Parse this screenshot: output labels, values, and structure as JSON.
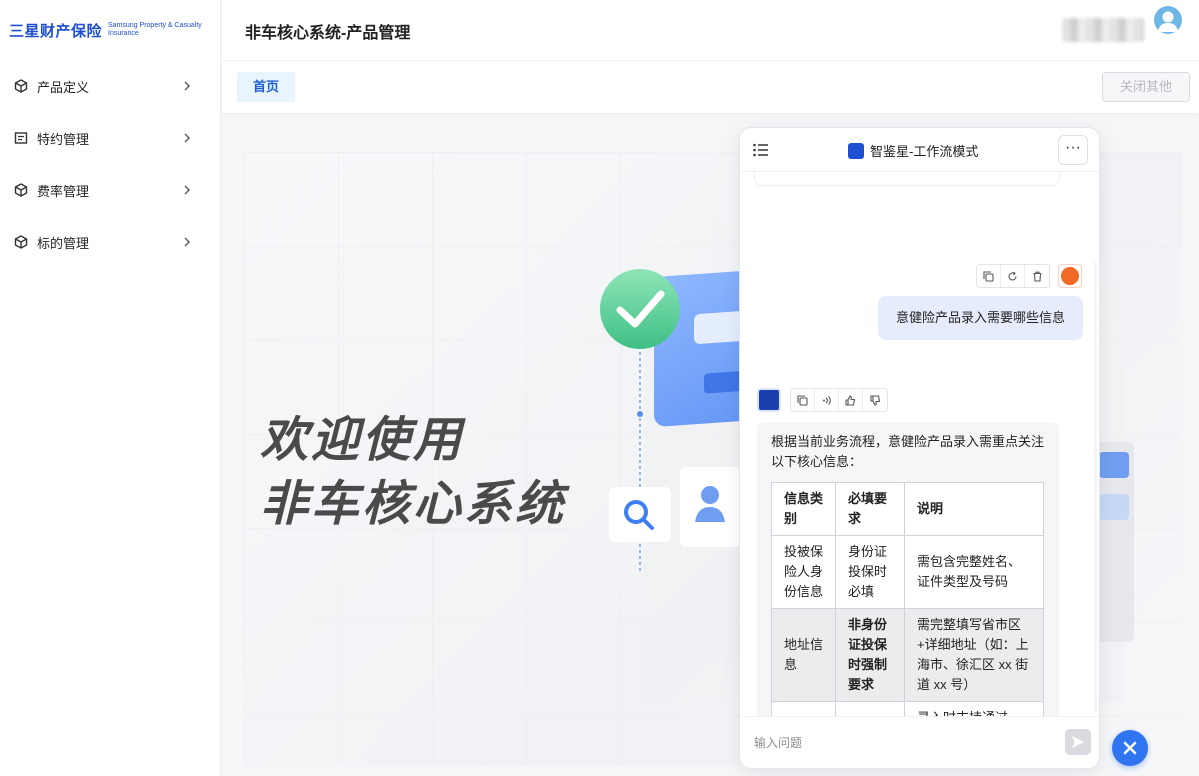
{
  "logo": {
    "main": "三星财产保险",
    "sub": "Samsung Property & Casualty Insurance"
  },
  "sidebar": {
    "items": [
      {
        "label": "产品定义",
        "icon": "cube-icon"
      },
      {
        "label": "特约管理",
        "icon": "document-icon"
      },
      {
        "label": "费率管理",
        "icon": "cube-icon"
      },
      {
        "label": "标的管理",
        "icon": "cube-icon"
      }
    ]
  },
  "header": {
    "title": "非车核心系统-产品管理"
  },
  "tabs": {
    "home": "首页",
    "close_others": "关闭其他"
  },
  "welcome": {
    "line1": "欢迎使用",
    "line2": "非车核心系统"
  },
  "chat": {
    "title": "智鉴星-工作流模式",
    "more": "···",
    "user_message": "意健险产品录入需要哪些信息",
    "bot_intro": "根据当前业务流程，意健险产品录入需重点关注以下核心信息：",
    "table": {
      "headers": [
        "信息类别",
        "必填要求",
        "说明"
      ],
      "rows": [
        {
          "category": "投被保险人身份信息",
          "required": "身份证投保时必填",
          "note": "需包含完整姓名、证件类型及号码"
        },
        {
          "category": "地址信息",
          "required": "非身份证投保时强制要求",
          "note": "需完整填写省市区+详细地址（如：上海市、徐汇区 xx 街道 xx 号）"
        },
        {
          "category": "",
          "required": "",
          "note": "录入时支持通过"
        }
      ]
    },
    "input_placeholder": "输入问题"
  },
  "colors": {
    "accent": "#1f4fd1",
    "fab": "#2f74f0",
    "user_bubble": "#e6ecfb",
    "tab_active_bg": "#e9f4fe"
  }
}
